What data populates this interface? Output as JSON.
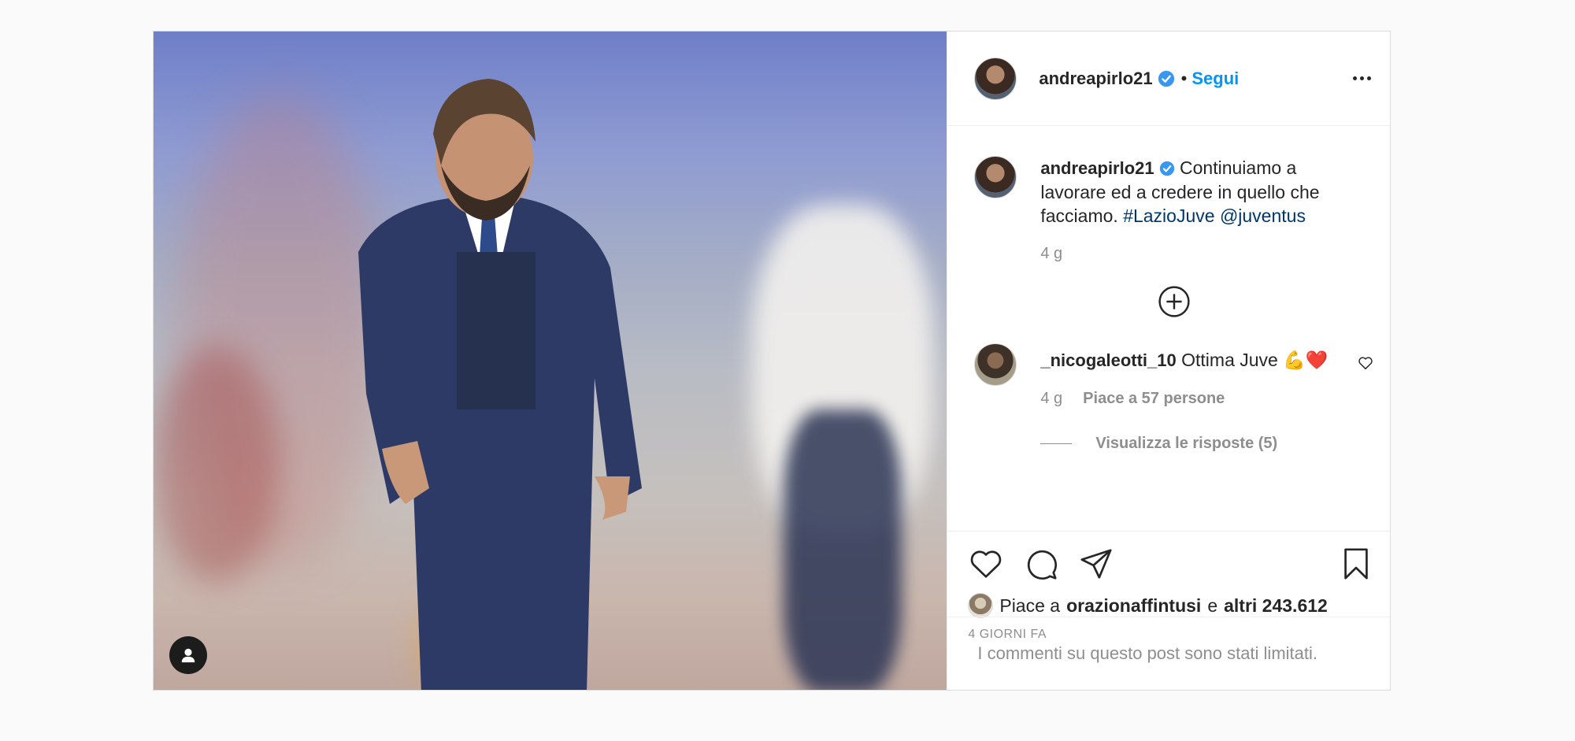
{
  "post": {
    "username": "andreapirlo21",
    "follow_label": "Segui",
    "separator": "•",
    "caption_text": "Continuiamo a lavorare ed a credere in quello che facciamo.",
    "hashtag": "#LazioJuve",
    "mention": "@juventus",
    "caption_time": "4 g"
  },
  "comment": {
    "username": "_nicogaleotti_10",
    "text": "Ottima Juve 💪❤️",
    "time": "4 g",
    "likes_label": "Piace a 57 persone",
    "replies_label": "Visualizza le risposte (5)"
  },
  "likes": {
    "prefix": "Piace a",
    "user": "orazionaffintusi",
    "joiner": "e",
    "others": "altri 243.612"
  },
  "timestamp": "4 GIORNI FA",
  "comments_limited": "I commenti su questo post sono stati limitati.",
  "colors": {
    "link": "#0095f6",
    "hashtag": "#00376b",
    "verified": "#3897f0"
  }
}
